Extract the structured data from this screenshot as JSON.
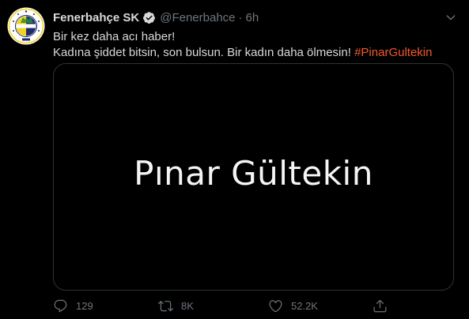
{
  "tweet": {
    "author": {
      "name": "Fenerbahçe SK",
      "handle": "@Fenerbahce",
      "time": "6h"
    },
    "text_lines": [
      "Bir kez daha acı haber!",
      "Kadına şiddet bitsin, son bulsun. Bir kadın daha ölmesin! "
    ],
    "hashtag": "#PinarGultekin",
    "media": {
      "title": "Pınar Gültekin"
    },
    "actions": {
      "reply_count": "129",
      "retweet_count": "8K",
      "like_count": "52.2K"
    },
    "avatar_text": "FENERBAHÇE SPOR KULÜBÜ 1907"
  },
  "colors": {
    "background": "#000000",
    "text": "#d9d9d9",
    "secondary": "#6e767d",
    "hashtag": "#f4592b",
    "verified": "#d9d9d9",
    "club_yellow": "#f3d21f",
    "club_navy": "#1c2c6b"
  },
  "icons": {
    "verified": "verified-badge-icon",
    "caret": "chevron-down-icon",
    "reply": "reply-icon",
    "retweet": "retweet-icon",
    "like": "heart-icon",
    "share": "share-icon"
  }
}
